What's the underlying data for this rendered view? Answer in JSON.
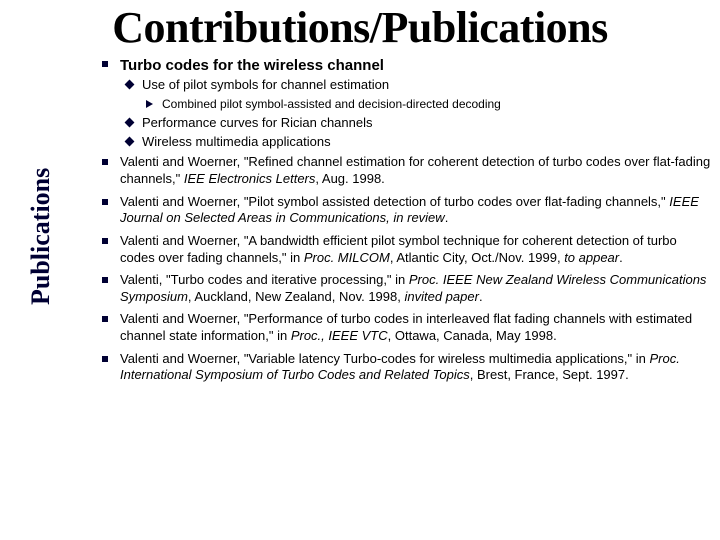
{
  "title": "Contributions/Publications",
  "sidelabel": "Publications",
  "topic": {
    "heading": "Turbo codes for the wireless channel",
    "sub1": "Use of pilot symbols for channel estimation",
    "sub1_detail": "Combined pilot symbol-assisted and decision-directed decoding",
    "sub2": "Performance curves for Rician channels",
    "sub3": "Wireless multimedia applications"
  },
  "pubs": [
    {
      "pre": "Valenti and Woerner, \"Refined channel estimation for coherent detection of turbo codes over flat-fading channels,\" ",
      "ital": "IEE Electronics Letters",
      "post": ", Aug. 1998."
    },
    {
      "pre": "Valenti and Woerner, \"Pilot symbol assisted detection of turbo codes over flat-fading channels,\" ",
      "ital": "IEEE Journal on Selected Areas in Communications, in review",
      "post": "."
    },
    {
      "pre": "Valenti and Woerner, \"A bandwidth efficient pilot symbol technique for coherent detection of turbo codes over fading channels,\" in ",
      "ital": "Proc. MILCOM",
      "post": ", Atlantic City, Oct./Nov. 1999, ",
      "ital2": "to appear",
      "post2": "."
    },
    {
      "pre": "Valenti, \"Turbo codes and iterative processing,\" in ",
      "ital": "Proc. IEEE New Zealand Wireless Communications Symposium",
      "post": ", Auckland, New Zealand, Nov. 1998, ",
      "ital2": "invited paper",
      "post2": "."
    },
    {
      "pre": "Valenti and Woerner, \"Performance of turbo codes in interleaved flat fading channels with estimated channel state information,\" in ",
      "ital": "Proc., IEEE VTC",
      "post": ", Ottawa, Canada, May 1998."
    },
    {
      "pre": "Valenti and Woerner, \"Variable latency Turbo-codes for wireless multimedia applications,\" in ",
      "ital": "Proc. International Symposium of Turbo Codes and Related Topics",
      "post": ", Brest, France, Sept. 1997."
    }
  ]
}
